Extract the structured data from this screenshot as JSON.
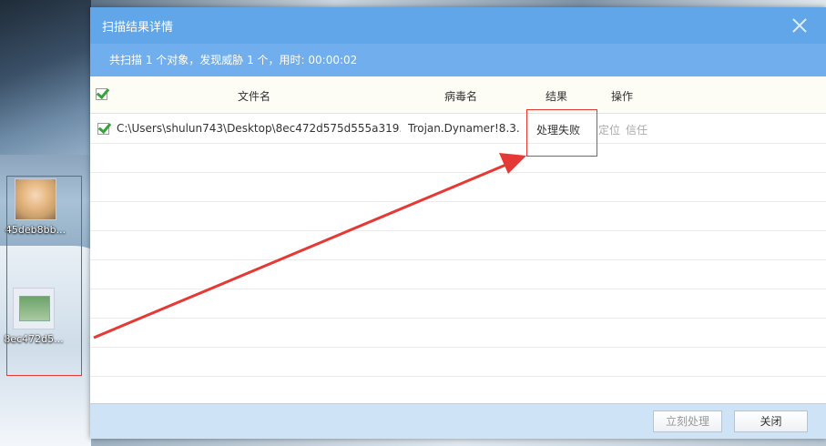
{
  "desktop": {
    "icons": [
      {
        "label": "45deb8bb...",
        "icon": "photo-thumbnail"
      },
      {
        "label": "8ec472d5...",
        "icon": "file-thumbnail"
      }
    ]
  },
  "dialog": {
    "title": "扫描结果详情",
    "summary": "共扫描 1 个对象，发现威胁 1 个，用时: 00:00:02",
    "columns": {
      "filename": "文件名",
      "virus": "病毒名",
      "result": "结果",
      "action": "操作"
    },
    "rows": [
      {
        "path": "C:\\Users\\shulun743\\Desktop\\8ec472d575d555a319...",
        "virus": "Trojan.Dynamer!8.3...",
        "result": "处理失败",
        "locate": "定位",
        "trust": "信任"
      }
    ],
    "buttons": {
      "process_now": "立刻处理",
      "close": "关闭"
    }
  },
  "colors": {
    "titlebar": "#62a6ea",
    "summary_bar": "#70aeee",
    "annotation_red": "#e53935",
    "check_green": "#33a33b"
  }
}
